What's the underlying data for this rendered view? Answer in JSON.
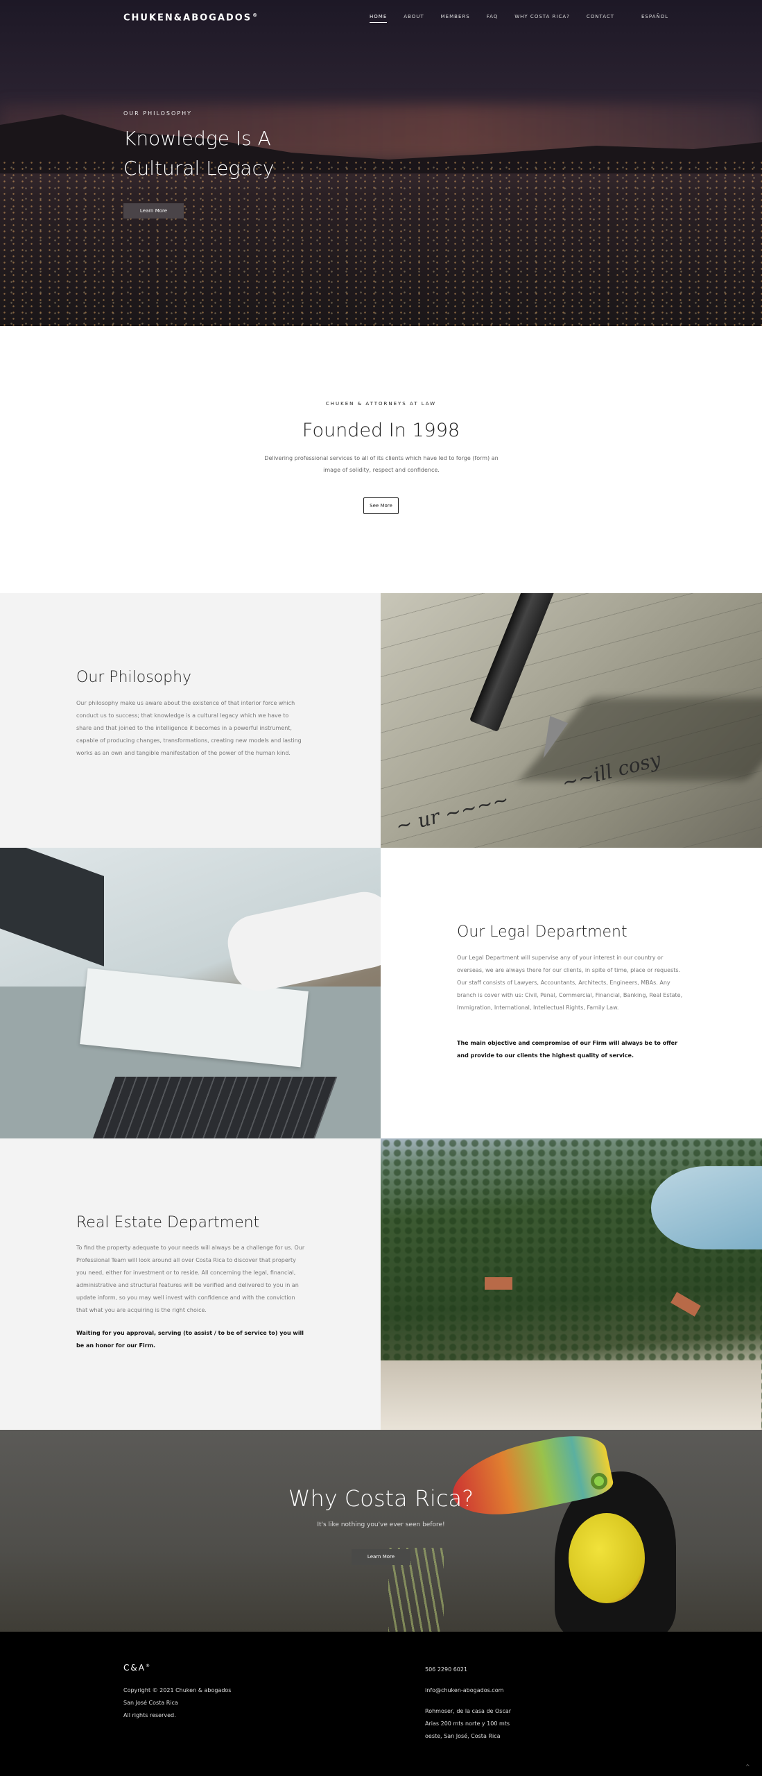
{
  "nav": {
    "logo": "CHUKEN&ABOGADOS",
    "logo_mark": "®",
    "items": [
      {
        "label": "HOME",
        "active": true
      },
      {
        "label": "ABOUT",
        "active": false
      },
      {
        "label": "MEMBERS",
        "active": false
      },
      {
        "label": "FAQ",
        "active": false
      },
      {
        "label": "WHY COSTA RICA?",
        "active": false
      },
      {
        "label": "CONTACT",
        "active": false
      }
    ],
    "language": "ESPAÑOL"
  },
  "hero": {
    "eyebrow": "OUR PHILOSOPHY",
    "title": "Knowledge Is A Cultural Legacy",
    "button": "Learn More"
  },
  "founded": {
    "kicker": "CHUKEN & ATTORNEYS AT LAW",
    "title": "Founded In 1998",
    "text": "Delivering professional services to all of its clients which have led to forge (form) an image of solidity, respect and confidence.",
    "button": "See More"
  },
  "philosophy": {
    "title": "Our Philosophy",
    "text": "Our philosophy make us aware about the existence of that interior force which conduct us to success; that knowledge is a cultural legacy which we have to share and that joined to the intelligence it becomes in a powerful instrument, capable of producing changes, transformations, creating new models and lasting works as an own and tangible manifestation of the power of the human kind."
  },
  "legal": {
    "title": "Our Legal Department",
    "text": "Our Legal Department will supervise any of your interest in our country or overseas, we are always there for our clients, in spite of time, place or requests. Our staff consists of Lawyers, Accountants, Architects, Engineers, MBAs. Any branch is cover with us: Civil, Penal, Commercial, Financial, Banking, Real Estate, Immigration, International, Intellectual Rights, Family Law.",
    "highlight": "The main objective and compromise of our Firm will always be to offer and provide to our clients the highest quality of service."
  },
  "real_estate": {
    "title": "Real Estate Department",
    "text": "To find the property adequate to your needs will always be a challenge for us. Our Professional Team will look around all over Costa Rica to discover that property you need, either for investment or to reside. All concerning the legal, financial, administrative and structural features will be verified and delivered to you in an update inform, so you may well invest with confidence and with the conviction that what you are acquiring is the right choice.",
    "highlight": "Waiting for you approval, serving (to assist / to be of service to) you will be an honor for our Firm."
  },
  "why": {
    "title": "Why Costa Rica?",
    "subtitle": "It's like nothing you've ever seen before!",
    "button": "Learn More"
  },
  "footer": {
    "logo": "C&A",
    "logo_mark": "®",
    "copyright": "Copyright © 2021 Chuken & abogados",
    "city": "San José Costa Rica",
    "rights": "All rights reserved.",
    "phone": "506 2290 6021",
    "email": "info@chuken-abogados.com",
    "address_1": "Rohmoser, de la casa de Oscar",
    "address_2": "Arias 200 mts norte y 100 mts",
    "address_3": "oeste, San José, Costa Rica",
    "to_top": "^"
  },
  "colors": {
    "section_gray": "#f3f3f3",
    "footer_bg": "#000000",
    "button_dark": "#4a4448"
  }
}
